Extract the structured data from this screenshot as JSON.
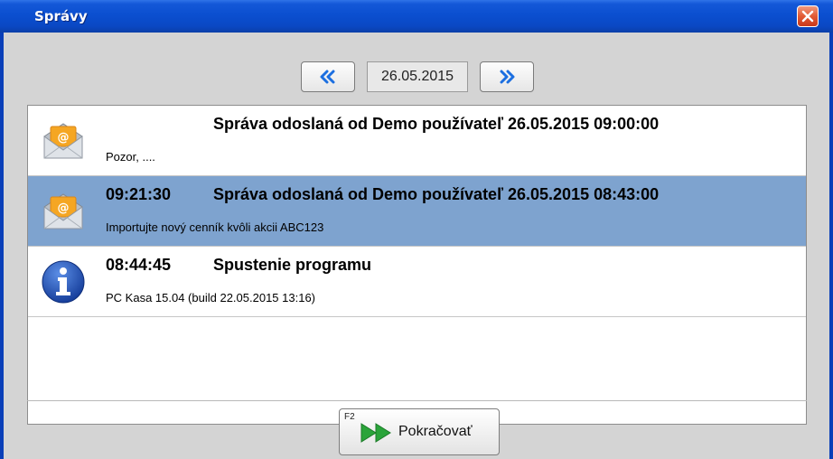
{
  "window": {
    "title": "Správy"
  },
  "nav": {
    "date": "26.05.2015"
  },
  "messages": [
    {
      "time": "",
      "title": "Správa odoslaná od Demo používateľ 26.05.2015 09:00:00",
      "body": "Pozor, ....",
      "icon": "mail-icon",
      "selected": false
    },
    {
      "time": "09:21:30",
      "title": "Správa odoslaná od Demo používateľ 26.05.2015 08:43:00",
      "body": "Importujte nový cenník kvôli akcii ABC123",
      "icon": "mail-icon",
      "selected": true
    },
    {
      "time": "08:44:45",
      "title": "Spustenie programu",
      "body": "PC Kasa 15.04 (build 22.05.2015 13:16)",
      "icon": "info-icon",
      "selected": false
    }
  ],
  "footer": {
    "shortcut": "F2",
    "continue_label": "Pokračovať"
  },
  "colors": {
    "title_bar": "#0b4fd0",
    "selected_row": "#7ea3cf",
    "nav_arrows": "#1c6fe0",
    "continue_arrows": "#2aa43a"
  }
}
